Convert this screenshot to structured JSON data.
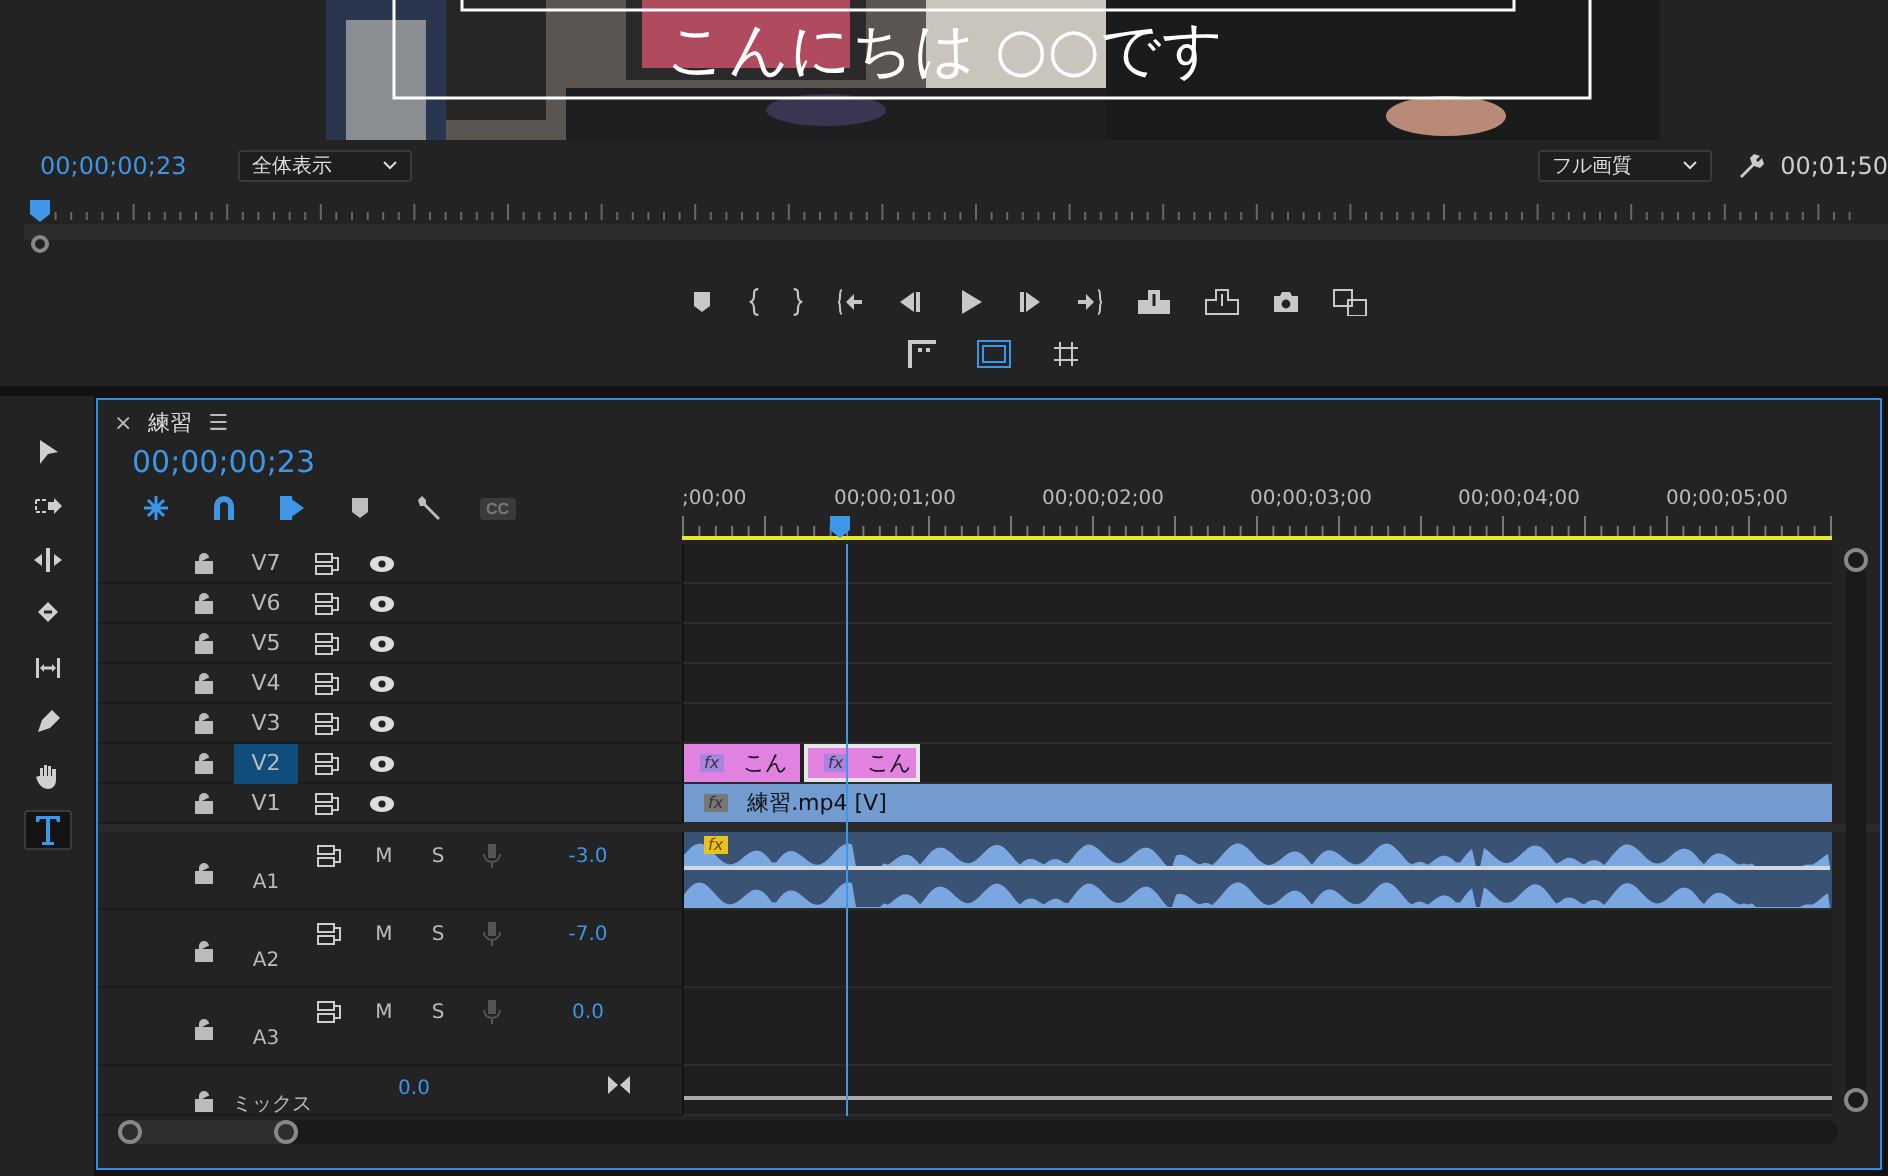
{
  "monitor": {
    "caption": "こんにちは ○○です",
    "timecode": "00;00;00;23",
    "zoom_dropdown": "全体表示",
    "quality_dropdown": "フル画質",
    "duration": "00;01;50",
    "view_buttons": [
      {
        "kind": "compare",
        "selected": false
      },
      {
        "kind": "safe-margins",
        "selected": true
      },
      {
        "kind": "grid",
        "selected": false
      }
    ]
  },
  "tools": [
    {
      "kind": "select",
      "selected": false
    },
    {
      "kind": "track-select",
      "selected": false
    },
    {
      "kind": "ripple",
      "selected": false
    },
    {
      "kind": "razor",
      "selected": false
    },
    {
      "kind": "slip",
      "selected": false
    },
    {
      "kind": "pen",
      "selected": false
    },
    {
      "kind": "hand",
      "selected": false
    },
    {
      "kind": "type",
      "selected": true
    }
  ],
  "timeline": {
    "tab": "練習",
    "close": "×",
    "menu": "☰",
    "timecode": "00;00;00;23",
    "toolbar": [
      {
        "kind": "nest",
        "on": true
      },
      {
        "kind": "snap",
        "on": true
      },
      {
        "kind": "linked",
        "on": true
      },
      {
        "kind": "marker",
        "on": false
      },
      {
        "kind": "settings",
        "on": false
      },
      {
        "kind": "captions",
        "on": false,
        "label": "CC"
      }
    ],
    "ruler": [
      ";00;00",
      "00;00;01;00",
      "00;00;02;00",
      "00;00;03;00",
      "00;00;04;00",
      "00;00;05;00"
    ],
    "video_tracks": [
      {
        "label": "V7",
        "selected": false
      },
      {
        "label": "V6",
        "selected": false
      },
      {
        "label": "V5",
        "selected": false
      },
      {
        "label": "V4",
        "selected": false
      },
      {
        "label": "V3",
        "selected": false
      },
      {
        "label": "V2",
        "selected": true,
        "clips": [
          {
            "kind": "title",
            "badge": "fx",
            "label": "こん",
            "selected": false
          },
          {
            "kind": "title",
            "badge": "fx",
            "label": "こん",
            "selected": true
          }
        ]
      },
      {
        "label": "V1",
        "selected": false,
        "clips": [
          {
            "kind": "video",
            "badge": "fx",
            "label": "練習.mp4 [V]",
            "selected": false
          }
        ]
      }
    ],
    "audio_tracks": [
      {
        "label": "A1",
        "mute": "M",
        "solo": "S",
        "volume": "-3.0",
        "clip": {
          "badge": "fx"
        }
      },
      {
        "label": "A2",
        "mute": "M",
        "solo": "S",
        "volume": "-7.0"
      },
      {
        "label": "A3",
        "mute": "M",
        "solo": "S",
        "volume": "0.0"
      }
    ],
    "mix": {
      "label": "ミックス",
      "volume": "0.0"
    }
  }
}
